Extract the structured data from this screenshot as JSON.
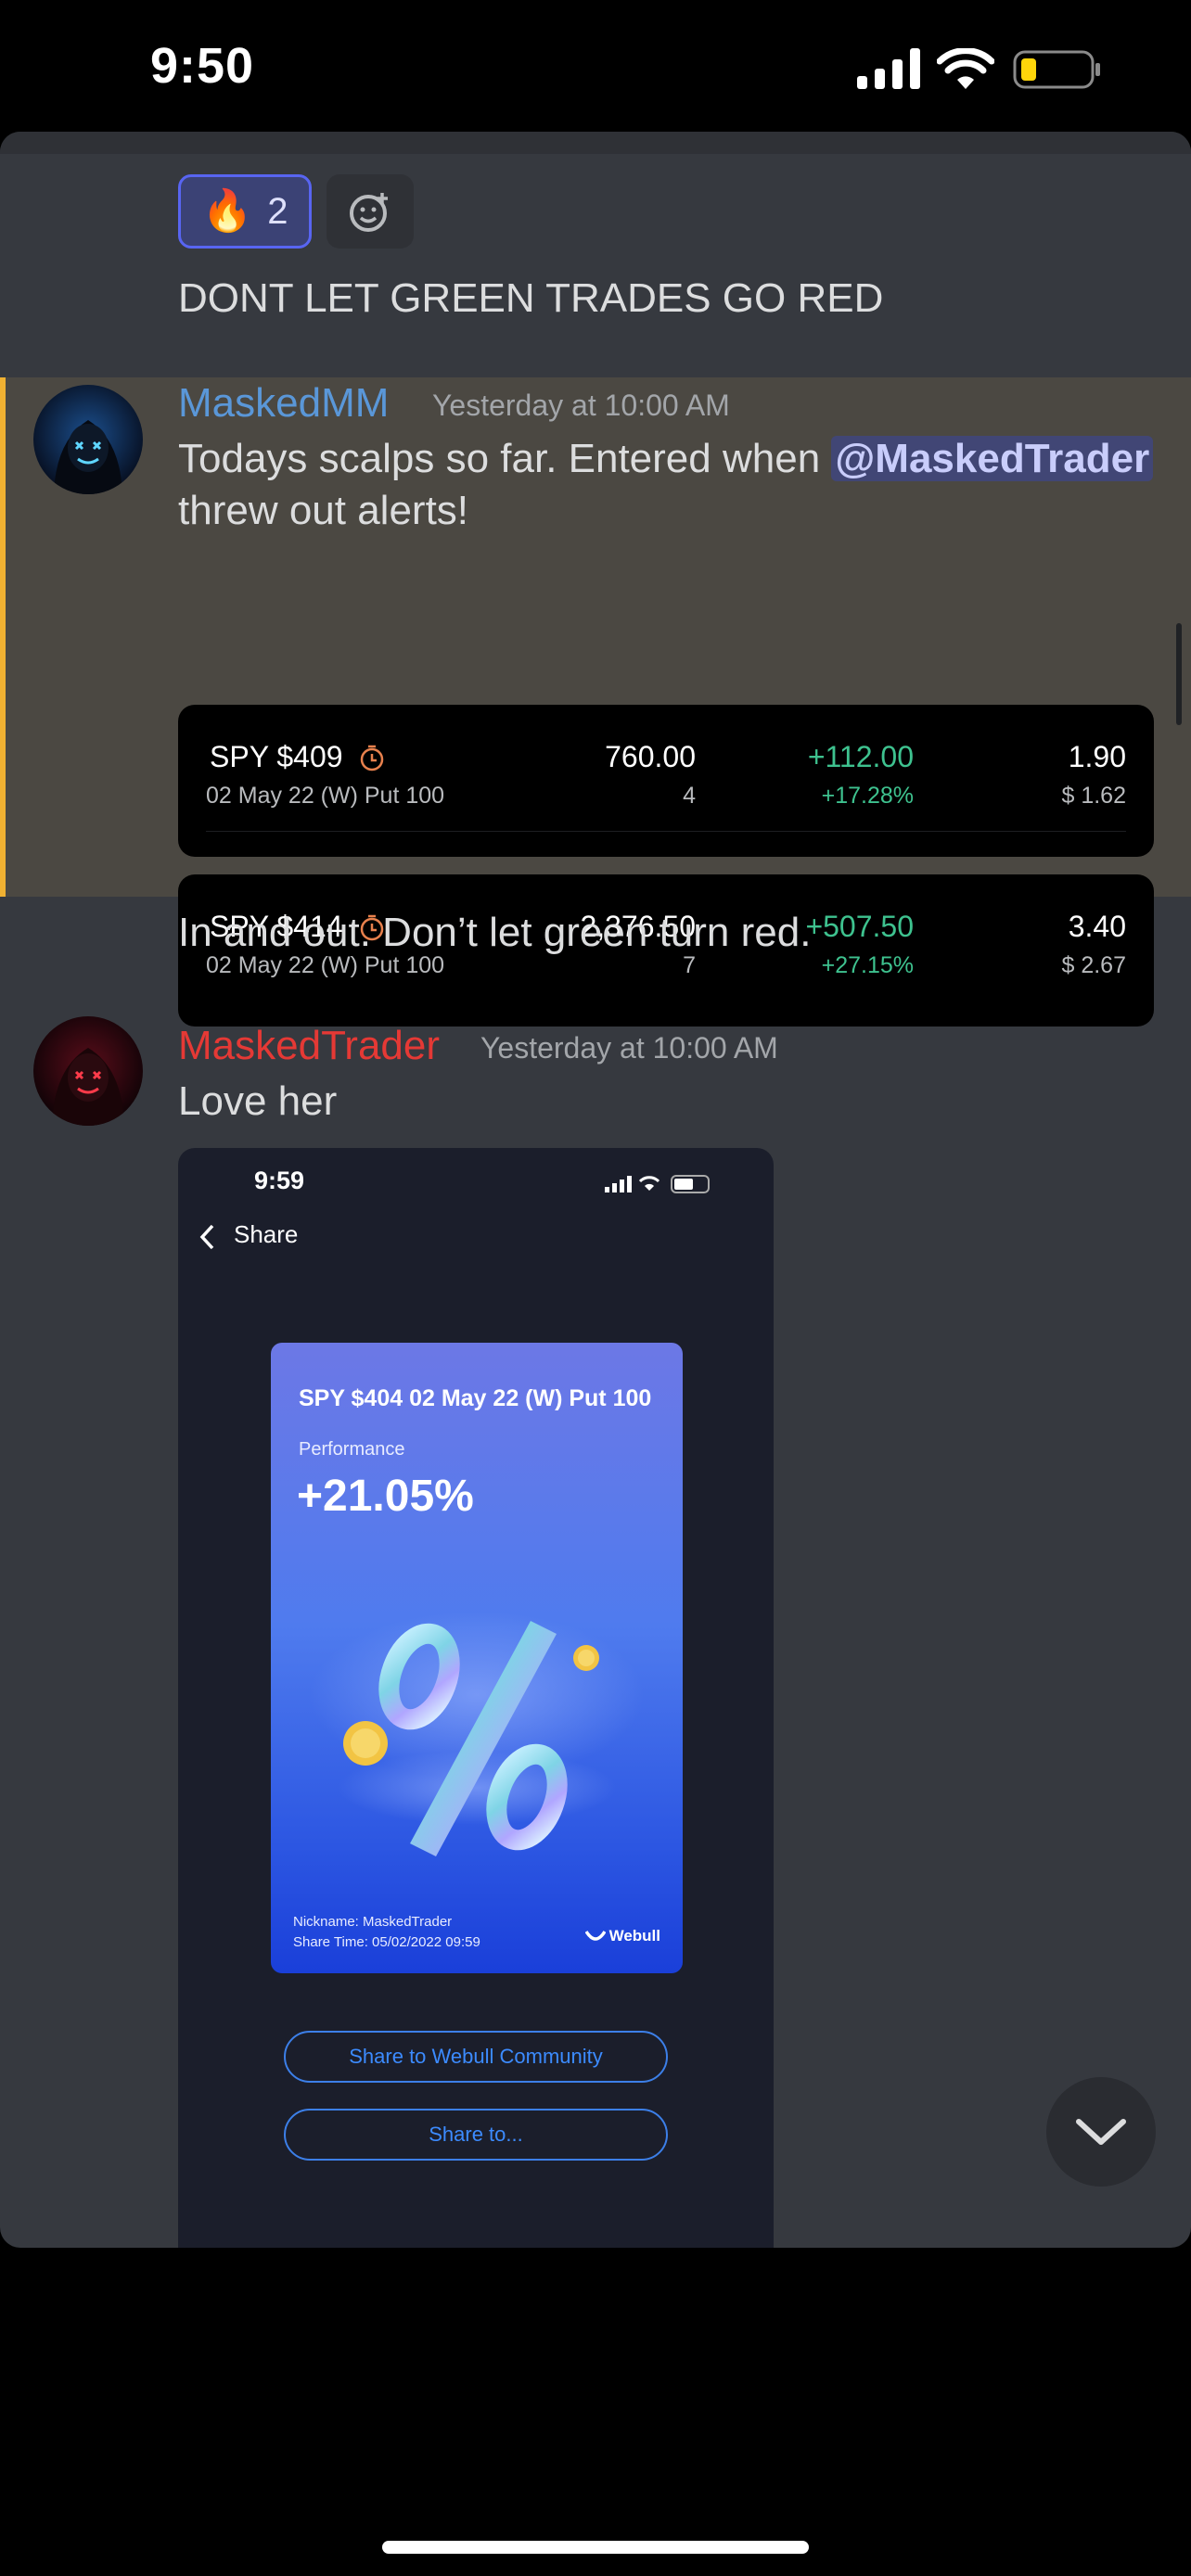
{
  "status_bar": {
    "time": "9:50"
  },
  "reaction": {
    "emoji": "🔥",
    "count": "2"
  },
  "messages": [
    {
      "text": "DONT LET GREEN TRADES GO RED"
    },
    {
      "username": "MaskedMM",
      "username_color": "#5a97d8",
      "timestamp": "Yesterday at 10:00 AM",
      "text_before": "Todays scalps so far. Entered when ",
      "mention": "@MaskedTrader",
      "text_after": "threw out alerts!",
      "trades": [
        {
          "symbol": "SPY $409",
          "contract": "02 May 22 (W) Put 100",
          "market_value": "760.00",
          "quantity": "4",
          "pl": "+112.00",
          "pl_pct": "+17.28%",
          "last": "1.90",
          "cost": "$ 1.62"
        },
        {
          "symbol": "SPY $414",
          "contract": "02 May 22 (W) Put 100",
          "market_value": "2,376.50",
          "quantity": "7",
          "pl": "+507.50",
          "pl_pct": "+27.15%",
          "last": "3.40",
          "cost": "$ 2.67"
        }
      ]
    },
    {
      "text": "In and out. Don’t let green turn red."
    },
    {
      "username": "MaskedTrader",
      "username_color": "#e53935",
      "timestamp": "Yesterday at 10:00 AM",
      "text": "Love her"
    }
  ],
  "embedded_screenshot": {
    "time": "9:59",
    "nav_title": "Share",
    "card": {
      "title": "SPY $404 02 May 22 (W) Put 100",
      "performance_label": "Performance",
      "performance_value": "+21.05%",
      "nickname": "Nickname: MaskedTrader",
      "share_time": "Share Time: 05/02/2022 09:59",
      "brand": "Webull"
    },
    "buttons": [
      "Share to Webull Community",
      "Share to..."
    ]
  },
  "colors": {
    "accent": "#5865f2",
    "highlight_bar": "#f0b132",
    "gain": "#3ec28f",
    "background": "#36393f"
  }
}
